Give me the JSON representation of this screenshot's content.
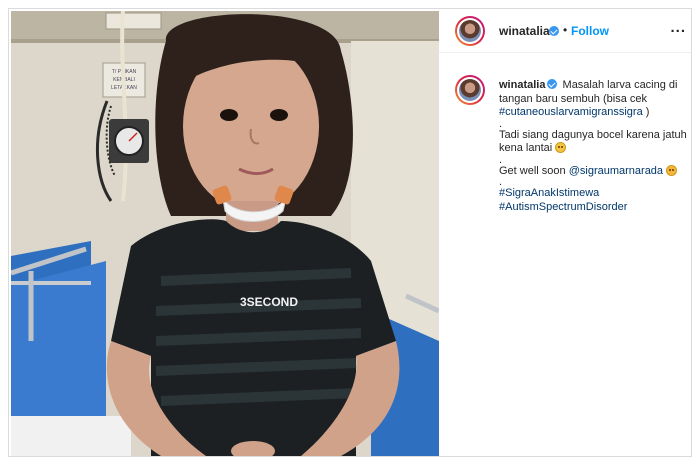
{
  "post": {
    "username": "winatalia",
    "follow_label": "Follow",
    "dot": "•",
    "more_label": "..."
  },
  "photo": {
    "shirt_text": "3SECOND",
    "wall_sign_lines": [
      "T/ PINKAN",
      "KEMBALI",
      "LETAKKAN"
    ]
  },
  "caption": {
    "username": "winatalia",
    "line1": "Masalah larva cacing di tangan baru sembuh (bisa cek",
    "hashtag1": "#cutaneouslarvamigranssigra",
    "line1_end": " )",
    "sep": ".",
    "line2": "Tadi siang dagunya bocel karena jatuh kena lantai",
    "line3": "Get well soon",
    "mention": "@sigraumarnarada",
    "hashtag2": "#SigraAnakIstimewa",
    "hashtag3": "#AutismSpectrumDisorder"
  },
  "colors": {
    "accent_blue": "#0095f6",
    "link_dark": "#00376b",
    "verified_blue": "#3897f0",
    "bed_blue": "#2f6fc0"
  }
}
